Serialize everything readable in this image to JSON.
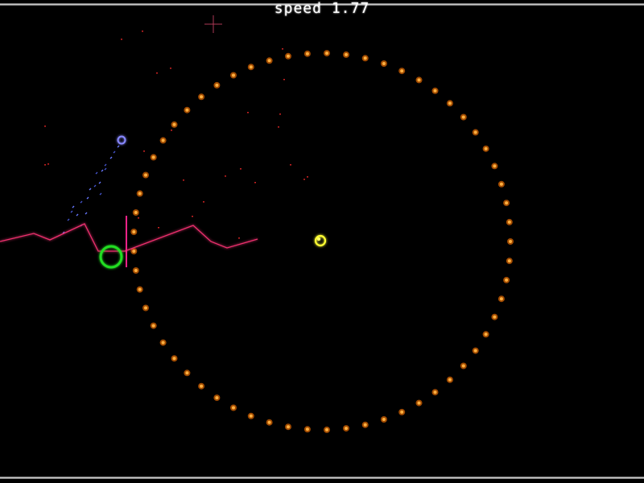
{
  "hud": {
    "speed_label": "speed",
    "speed_value": "1.77"
  },
  "colors": {
    "background": "#000000",
    "ring_dots": "#ff8c1a",
    "player_ship": "#ffff33",
    "target_ring": "#22dd22",
    "laser": "#ff3399",
    "enemy_probe": "#6666ff",
    "crosshair": "#cc4466",
    "debris": "#cc2222",
    "hud_text": "#ffffff"
  },
  "icons": {
    "player": "yellow-ring-ship",
    "target": "green-ring-target",
    "enemy": "blue-orb-probe",
    "crosshair": "crosshair-marker"
  },
  "arena": {
    "ring_dot_count": 61
  }
}
